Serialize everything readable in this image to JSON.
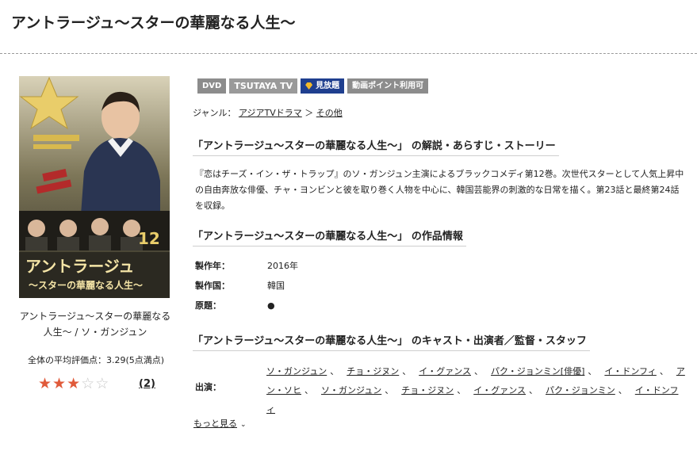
{
  "page": {
    "title": "アントラージュ〜スターの華麗なる人生〜"
  },
  "badges": {
    "dvd": "DVD",
    "tsutaya_tv": "TSUTAYA TV",
    "mihodai": "見放題",
    "points": "動画ポイント利用可"
  },
  "genre": {
    "label": "ジャンル：",
    "path": [
      "アジアTVドラマ",
      "その他"
    ],
    "separator": "＞"
  },
  "cover": {
    "volume": "12",
    "title_line1": "アントラージュ",
    "title_line2": "〜スターの華麗なる人生〜",
    "caption": "アントラージュ〜スターの華麗なる人生〜 / ソ・ガンジュン"
  },
  "rating": {
    "average_text": "全体の平均評価点：3.29(5点満点)",
    "value": 3.29,
    "max": 5,
    "review_count": "(2)",
    "star_colors": {
      "full": "#e05a3a",
      "empty": "#c8c8c8"
    }
  },
  "sections": {
    "synopsis_heading": "「アントラージュ〜スターの華麗なる人生〜」 の解説・あらすじ・ストーリー",
    "synopsis_text": "『恋はチーズ・イン・ザ・トラップ』のソ・ガンジュン主演によるブラックコメディ第12巻。次世代スターとして人気上昇中の自由奔放な俳優、チャ・ヨンビンと彼を取り巻く人物を中心に、韓国芸能界の刺激的な日常を描く。第23話と最終第24話を収録。",
    "info_heading": "「アントラージュ〜スターの華麗なる人生〜」 の作品情報",
    "cast_heading": "「アントラージュ〜スターの華麗なる人生〜」 のキャスト・出演者／監督・スタッフ"
  },
  "info": [
    {
      "label": "製作年：",
      "value": "2016年"
    },
    {
      "label": "製作国：",
      "value": "韓国"
    },
    {
      "label": "原題：",
      "value": "●"
    }
  ],
  "cast": {
    "label": "出演：",
    "names": [
      "ソ・ガンジュン",
      "チョ・ジヌン",
      "イ・グァンス",
      "パク・ジョンミン[俳優]",
      "イ・ドンフィ",
      "アン・ソヒ",
      "ソ・ガンジュン",
      "チョ・ジヌン",
      "イ・グァンス",
      "パク・ジョンミン",
      "イ・ドンフィ"
    ],
    "separator": "、"
  },
  "more_link": {
    "label": "もっと見る"
  }
}
